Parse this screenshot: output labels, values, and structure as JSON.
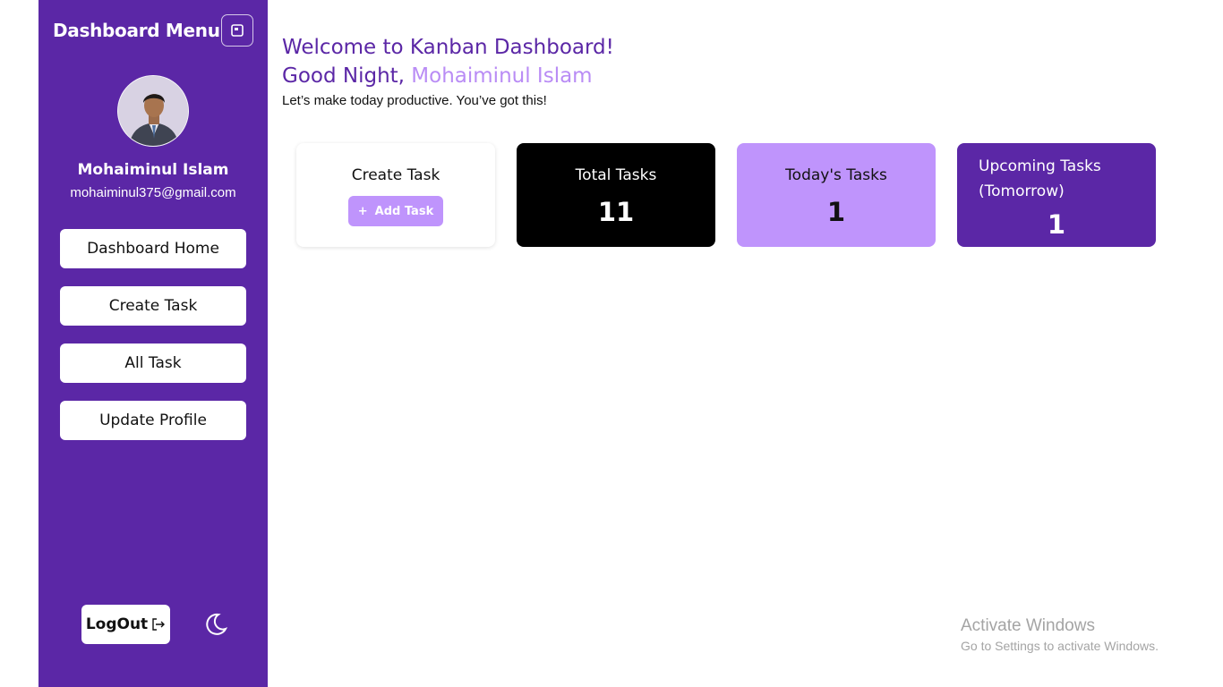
{
  "sidebar": {
    "title": "Dashboard Menu",
    "user": {
      "name": "Mohaiminul Islam",
      "email": "mohaiminul375@gmail.com"
    },
    "nav": [
      {
        "label": "Dashboard Home"
      },
      {
        "label": "Create Task"
      },
      {
        "label": "All Task"
      },
      {
        "label": "Update Profile"
      }
    ],
    "logout_label": "LogOut"
  },
  "main": {
    "welcome": "Welcome to Kanban Dashboard!",
    "greeting_prefix": "Good Night,",
    "greeting_name": "Mohaiminul Islam",
    "subline": "Let’s make today productive. You’ve got this!"
  },
  "cards": {
    "create": {
      "title": "Create Task",
      "button_label": "Add Task"
    },
    "total": {
      "title": "Total Tasks",
      "value": "11"
    },
    "today": {
      "title": "Today's Tasks",
      "value": "1"
    },
    "upcoming": {
      "title": "Upcoming Tasks (Tomorrow)",
      "value": "1"
    }
  },
  "watermark": {
    "line1": "Activate Windows",
    "line2": "Go to Settings to activate Windows."
  },
  "colors": {
    "accent": "#5b27a6",
    "light_accent": "#bf94fc",
    "dark": "#000000"
  },
  "icons": {
    "collapse": "sidebar-collapse-icon",
    "logout": "logout-arrow-icon",
    "theme": "moon-icon",
    "add": "plus-icon"
  }
}
